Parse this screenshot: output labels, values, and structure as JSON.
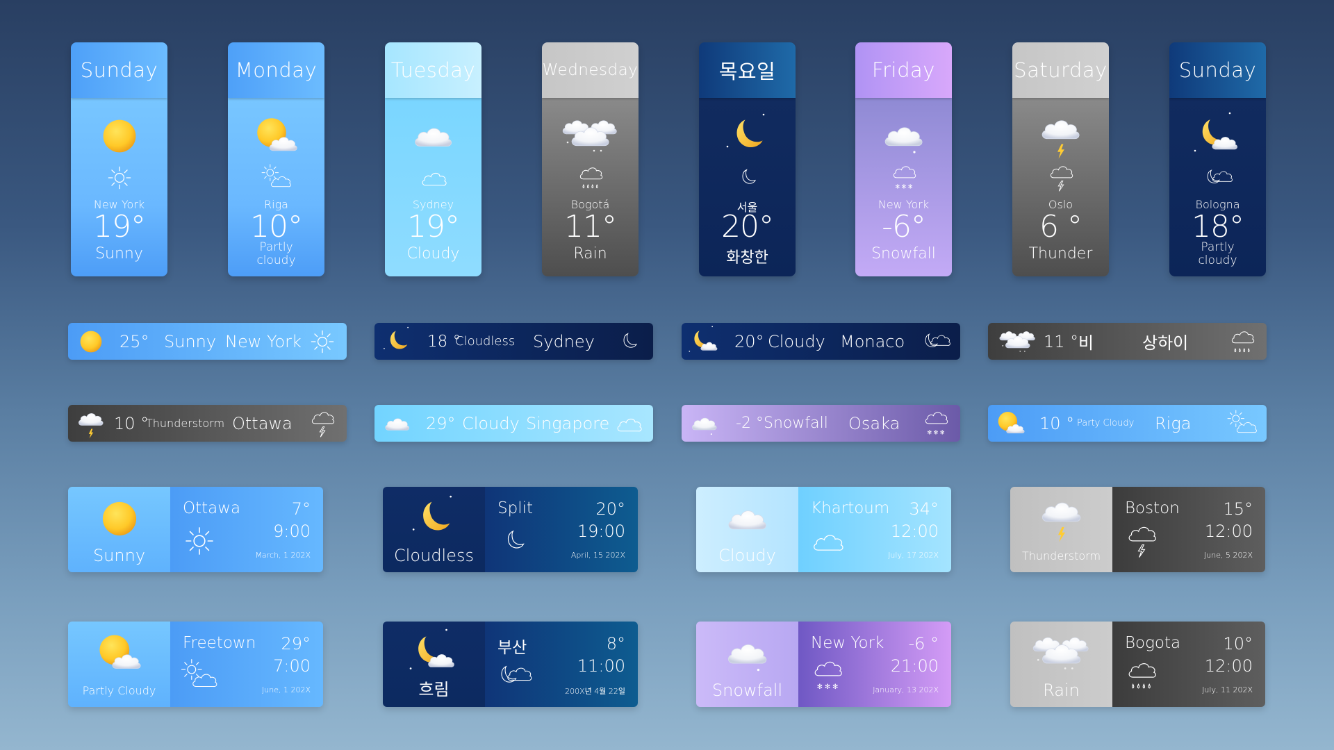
{
  "colors": {
    "sunny_blue": "#4fa3fb",
    "light_cyan": "#7fd8ff",
    "gray": "#5a5a5a",
    "navy": "#0f2a5c",
    "lavender": "#b39cf0",
    "moon_yellow": "#ffcc33"
  },
  "vertical_cards": [
    {
      "day": "Sunday",
      "city": "New York",
      "temp": "19°",
      "condition": "Sunny",
      "theme": "sunny",
      "icon": "sun-icon",
      "outline_icon": "sun-outline-icon"
    },
    {
      "day": "Monday",
      "city": "Riga",
      "temp": "10°",
      "condition": "Partly cloudy",
      "theme": "sunny",
      "icon": "partly-cloudy-icon",
      "outline_icon": "partly-cloudy-outline-icon"
    },
    {
      "day": "Tuesday",
      "city": "Sydney",
      "temp": "19°",
      "condition": "Cloudy",
      "theme": "cyan",
      "icon": "cloud-icon",
      "outline_icon": "cloud-outline-icon"
    },
    {
      "day": "Wednesday",
      "city": "Bogotá",
      "temp": "11°",
      "condition": "Rain",
      "theme": "gray",
      "icon": "rain-cloud-icon",
      "outline_icon": "rain-outline-icon"
    },
    {
      "day": "목요일",
      "city": "서울",
      "temp": "20°",
      "condition": "화창한",
      "theme": "navy",
      "icon": "moon-icon",
      "outline_icon": "moon-outline-icon"
    },
    {
      "day": "Friday",
      "city": "New York",
      "temp": "-6°",
      "condition": "Snowfall",
      "theme": "lavender",
      "icon": "snow-cloud-icon",
      "outline_icon": "snow-outline-icon"
    },
    {
      "day": "Saturday",
      "city": "Oslo",
      "temp": "6 °",
      "condition": "Thunder",
      "theme": "gray",
      "icon": "thunder-cloud-icon",
      "outline_icon": "thunder-outline-icon"
    },
    {
      "day": "Sunday",
      "city": "Bologna",
      "temp": "18°",
      "condition": "Partly cloudy",
      "theme": "navy",
      "icon": "moon-cloud-icon",
      "outline_icon": "moon-cloud-outline-icon"
    }
  ],
  "banners": [
    {
      "temp": "25°",
      "condition": "Sunny",
      "city": "New York",
      "theme": "sunny"
    },
    {
      "temp": "18 °",
      "condition": "Cloudless",
      "city": "Sydney",
      "theme": "navy"
    },
    {
      "temp": "20°",
      "condition": "Cloudy",
      "city": "Monaco",
      "theme": "navy"
    },
    {
      "temp": "11 °",
      "condition": "비",
      "city": "상하이",
      "theme": "gray"
    },
    {
      "temp": "10 °",
      "condition": "Thunderstorm",
      "city": "Ottawa",
      "theme": "gray"
    },
    {
      "temp": "29°",
      "condition": "Cloudy",
      "city": "Singapore",
      "theme": "cyan"
    },
    {
      "temp": "-2 °",
      "condition": "Snowfall",
      "city": "Osaka",
      "theme": "lavender"
    },
    {
      "temp": "10 °",
      "condition": "Party Cloudy",
      "city": "Riga",
      "theme": "sunny"
    }
  ],
  "wide_cards": [
    {
      "condition": "Sunny",
      "city": "Ottawa",
      "temp": "7°",
      "time": "9:00",
      "date": "March, 1 202X",
      "theme": "sunny"
    },
    {
      "condition": "Cloudless",
      "city": "Split",
      "temp": "20°",
      "time": "19:00",
      "date": "April, 15 202X",
      "theme": "navy"
    },
    {
      "condition": "Cloudy",
      "city": "Khartoum",
      "temp": "34°",
      "time": "12:00",
      "date": "July, 17 202X",
      "theme": "cyan"
    },
    {
      "condition": "Thunderstorm",
      "city": "Boston",
      "temp": "15°",
      "time": "12:00",
      "date": "June, 5 202X",
      "theme": "gray"
    },
    {
      "condition": "Partly Cloudy",
      "city": "Freetown",
      "temp": "29°",
      "time": "7:00",
      "date": "June, 1 202X",
      "theme": "sunny"
    },
    {
      "condition": "흐림",
      "city": "부산",
      "temp": "8°",
      "time": "11:00",
      "date": "200X년 4월 22일",
      "theme": "navy"
    },
    {
      "condition": "Snowfall",
      "city": "New York",
      "temp": "-6 °",
      "time": "21:00",
      "date": "January, 13 202X",
      "theme": "lavender"
    },
    {
      "condition": "Rain",
      "city": "Bogota",
      "temp": "10°",
      "time": "12:00",
      "date": "July, 11 202X",
      "theme": "gray"
    }
  ]
}
